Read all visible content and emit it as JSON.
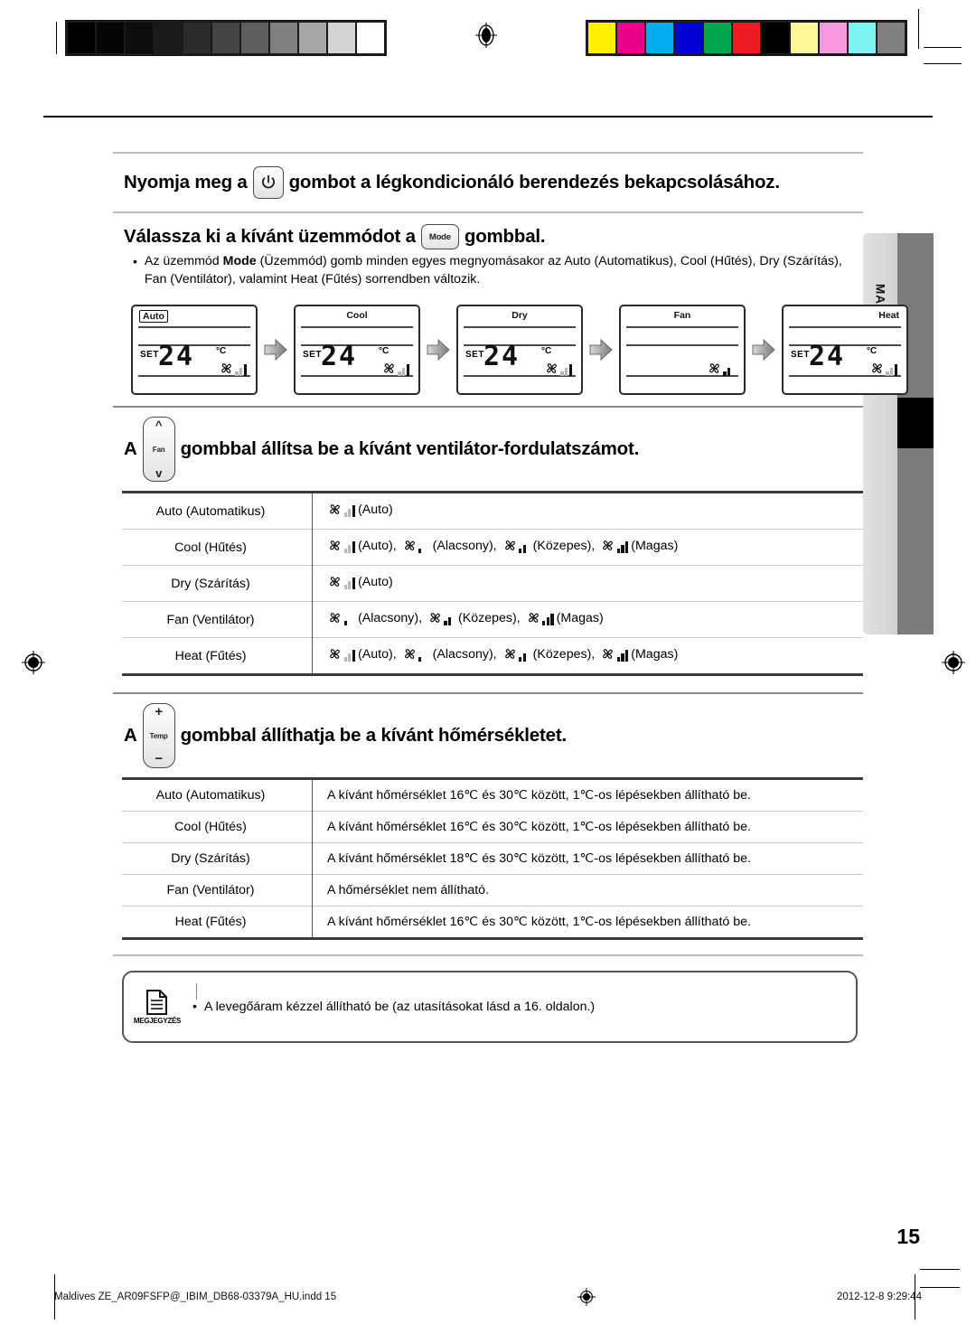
{
  "document": {
    "language_tab": "MAGYAR",
    "page_number": "15",
    "footer_file": "Maldives ZE_AR09FSFP@_IBIM_DB68-03379A_HU.indd   15",
    "footer_timestamp": "2012-12-8   9:29:44"
  },
  "prepress": {
    "grayscale_swatches": [
      "#000000",
      "#050505",
      "#0d0d0d",
      "#1a1a1a",
      "#2b2b2b",
      "#444444",
      "#5e5e5e",
      "#808080",
      "#a6a6a6",
      "#d4d4d4",
      "#ffffff"
    ],
    "color_swatches": [
      "#fff000",
      "#ec008c",
      "#00aeef",
      "#0000d4",
      "#00a651",
      "#ed1c24",
      "#000000",
      "#fff79a",
      "#f99ae0",
      "#7df4f4",
      "#808080"
    ],
    "registration_icon": "registration-target-icon"
  },
  "steps": {
    "power": {
      "text_before": "Nyomja meg a",
      "button_icon": "power-icon",
      "text_after": "gombot a légkondicionáló berendezés bekapcsolásához."
    },
    "mode": {
      "text_before": "Válassza ki a kívánt üzemmódot a",
      "button_label": "Mode",
      "text_after": "gombbal.",
      "bullet_dot": "•",
      "bullet_part1": "Az üzemmód ",
      "bullet_bold": "Mode",
      "bullet_part2": " (Üzemmód) gomb minden egyes megnyomásakor az Auto (Automatikus), Cool (Hűtés), Dry (Szárítás), Fan (Ventilátor), valamint Heat (Fűtés) sorrendben változik."
    },
    "fan": {
      "text_before": "A",
      "button_label": "Fan",
      "text_after": "gombbal állítsa be a kívánt ventilátor-fordulatszámot."
    },
    "temp": {
      "text_before": "A",
      "button_label": "Temp",
      "button_plus": "+",
      "button_minus": "−",
      "text_after": "gombbal állíthatja be a kívánt hőmérsékletet."
    }
  },
  "lcd_sequence": [
    {
      "mode": "Auto",
      "align": "left",
      "set": "SET",
      "temp": "24",
      "unit": "°C",
      "show_temp": true,
      "fan": "auto"
    },
    {
      "mode": "Cool",
      "align": "center",
      "set": "SET",
      "temp": "24",
      "unit": "°C",
      "show_temp": true,
      "fan": "auto"
    },
    {
      "mode": "Dry",
      "align": "center",
      "set": "SET",
      "temp": "24",
      "unit": "°C",
      "show_temp": true,
      "fan": "auto"
    },
    {
      "mode": "Fan",
      "align": "center",
      "set": "",
      "temp": "",
      "unit": "",
      "show_temp": false,
      "fan": "med"
    },
    {
      "mode": "Heat",
      "align": "right",
      "set": "SET",
      "temp": "24",
      "unit": "°C",
      "show_temp": true,
      "fan": "auto"
    }
  ],
  "fan_table": {
    "rows": [
      {
        "mode": "Auto (Automatikus)",
        "speeds": [
          {
            "level": "auto",
            "label": "(Auto)"
          }
        ]
      },
      {
        "mode": "Cool (Hűtés)",
        "speeds": [
          {
            "level": "auto",
            "label": "(Auto),"
          },
          {
            "level": "low",
            "label": "(Alacsony),"
          },
          {
            "level": "med",
            "label": "(Közepes),"
          },
          {
            "level": "high",
            "label": "(Magas)"
          }
        ]
      },
      {
        "mode": "Dry (Szárítás)",
        "speeds": [
          {
            "level": "auto",
            "label": "(Auto)"
          }
        ]
      },
      {
        "mode": "Fan (Ventilátor)",
        "speeds": [
          {
            "level": "low",
            "label": "(Alacsony),"
          },
          {
            "level": "med",
            "label": "(Közepes),"
          },
          {
            "level": "high",
            "label": "(Magas)"
          }
        ]
      },
      {
        "mode": "Heat (Fűtés)",
        "speeds": [
          {
            "level": "auto",
            "label": "(Auto),"
          },
          {
            "level": "low",
            "label": "(Alacsony),"
          },
          {
            "level": "med",
            "label": "(Közepes),"
          },
          {
            "level": "high",
            "label": "(Magas)"
          }
        ]
      }
    ]
  },
  "temp_table": {
    "rows": [
      {
        "mode": "Auto (Automatikus)",
        "desc": "A kívánt hőmérséklet 16℃ és 30℃ között, 1℃-os lépésekben állítható be."
      },
      {
        "mode": "Cool (Hűtés)",
        "desc": "A kívánt hőmérséklet 16℃ és 30℃ között, 1℃-os lépésekben állítható be."
      },
      {
        "mode": "Dry (Szárítás)",
        "desc": "A kívánt hőmérséklet 18℃ és 30℃ között, 1℃-os lépésekben állítható be."
      },
      {
        "mode": "Fan (Ventilátor)",
        "desc": "A hőmérséklet nem állítható."
      },
      {
        "mode": "Heat (Fűtés)",
        "desc": "A kívánt hőmérséklet 16℃ és 30℃ között, 1℃-os lépésekben állítható be."
      }
    ]
  },
  "note": {
    "icon": "note-document-icon",
    "caption": "MEGJEGYZÉS",
    "bullet_dot": "•",
    "text": "A levegőáram kézzel állítható be (az utasításokat lásd a 16. oldalon.)"
  }
}
